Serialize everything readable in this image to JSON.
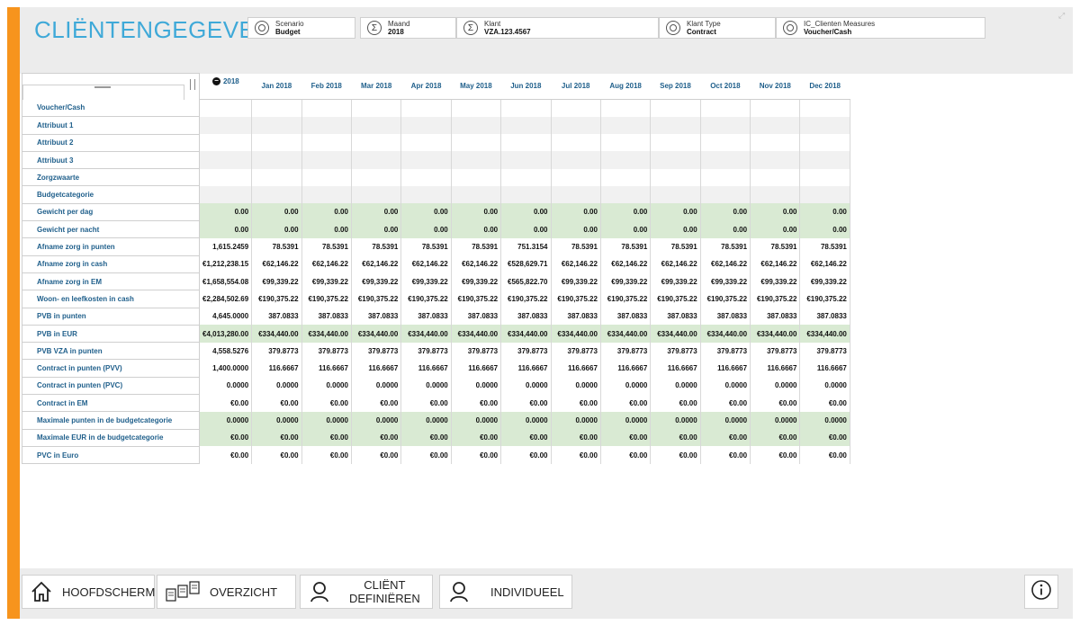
{
  "header": {
    "title": "CLIËNTENGEGEVENS",
    "filters": [
      {
        "label": "Scenario",
        "value": "Budget",
        "icon": "circle-icon"
      },
      {
        "label": "Maand",
        "value": "2018",
        "icon": "sigma-icon"
      },
      {
        "label": "Klant",
        "value": "VZA.123.4567",
        "icon": "sigma-icon"
      },
      {
        "label": "Klant Type",
        "value": "Contract",
        "icon": "circle-icon"
      },
      {
        "label": "IC_Clienten Measures",
        "value": "Voucher/Cash",
        "icon": "circle-icon"
      }
    ]
  },
  "grid": {
    "columns": [
      "2018",
      "Jan 2018",
      "Feb 2018",
      "Mar 2018",
      "Apr 2018",
      "May 2018",
      "Jun 2018",
      "Jul 2018",
      "Aug 2018",
      "Sep 2018",
      "Oct 2018",
      "Nov 2018",
      "Dec 2018"
    ],
    "rows": [
      {
        "label": "Voucher/Cash",
        "style": "plain",
        "values": [
          "",
          "",
          "",
          "",
          "",
          "",
          "",
          "",
          "",
          "",
          "",
          "",
          ""
        ]
      },
      {
        "label": "Attribuut 1",
        "style": "alt",
        "values": [
          "",
          "",
          "",
          "",
          "",
          "",
          "",
          "",
          "",
          "",
          "",
          "",
          ""
        ]
      },
      {
        "label": "Attribuut 2",
        "style": "plain",
        "values": [
          "",
          "",
          "",
          "",
          "",
          "",
          "",
          "",
          "",
          "",
          "",
          "",
          ""
        ]
      },
      {
        "label": "Attribuut 3",
        "style": "alt",
        "values": [
          "",
          "",
          "",
          "",
          "",
          "",
          "",
          "",
          "",
          "",
          "",
          "",
          ""
        ]
      },
      {
        "label": "Zorgzwaarte",
        "style": "plain",
        "values": [
          "",
          "",
          "",
          "",
          "",
          "",
          "",
          "",
          "",
          "",
          "",
          "",
          ""
        ]
      },
      {
        "label": "Budgetcategorie",
        "style": "alt",
        "values": [
          "",
          "",
          "",
          "",
          "",
          "",
          "",
          "",
          "",
          "",
          "",
          "",
          ""
        ]
      },
      {
        "label": "Gewicht per dag",
        "style": "green",
        "values": [
          "0.00",
          "0.00",
          "0.00",
          "0.00",
          "0.00",
          "0.00",
          "0.00",
          "0.00",
          "0.00",
          "0.00",
          "0.00",
          "0.00",
          "0.00"
        ]
      },
      {
        "label": "Gewicht per nacht",
        "style": "green",
        "values": [
          "0.00",
          "0.00",
          "0.00",
          "0.00",
          "0.00",
          "0.00",
          "0.00",
          "0.00",
          "0.00",
          "0.00",
          "0.00",
          "0.00",
          "0.00"
        ]
      },
      {
        "label": "Afname zorg in punten",
        "style": "plain",
        "values": [
          "1,615.2459",
          "78.5391",
          "78.5391",
          "78.5391",
          "78.5391",
          "78.5391",
          "751.3154",
          "78.5391",
          "78.5391",
          "78.5391",
          "78.5391",
          "78.5391",
          "78.5391"
        ]
      },
      {
        "label": "Afname zorg in cash",
        "style": "plain",
        "values": [
          "€1,212,238.15",
          "€62,146.22",
          "€62,146.22",
          "€62,146.22",
          "€62,146.22",
          "€62,146.22",
          "€528,629.71",
          "€62,146.22",
          "€62,146.22",
          "€62,146.22",
          "€62,146.22",
          "€62,146.22",
          "€62,146.22"
        ]
      },
      {
        "label": "Afname zorg in EM",
        "style": "plain",
        "values": [
          "€1,658,554.08",
          "€99,339.22",
          "€99,339.22",
          "€99,339.22",
          "€99,339.22",
          "€99,339.22",
          "€565,822.70",
          "€99,339.22",
          "€99,339.22",
          "€99,339.22",
          "€99,339.22",
          "€99,339.22",
          "€99,339.22"
        ]
      },
      {
        "label": "Woon- en leefkosten in cash",
        "style": "plain",
        "values": [
          "€2,284,502.69",
          "€190,375.22",
          "€190,375.22",
          "€190,375.22",
          "€190,375.22",
          "€190,375.22",
          "€190,375.22",
          "€190,375.22",
          "€190,375.22",
          "€190,375.22",
          "€190,375.22",
          "€190,375.22",
          "€190,375.22"
        ]
      },
      {
        "label": "PVB in punten",
        "style": "plain",
        "values": [
          "4,645.0000",
          "387.0833",
          "387.0833",
          "387.0833",
          "387.0833",
          "387.0833",
          "387.0833",
          "387.0833",
          "387.0833",
          "387.0833",
          "387.0833",
          "387.0833",
          "387.0833"
        ]
      },
      {
        "label": "PVB in EUR",
        "style": "green",
        "values": [
          "€4,013,280.00",
          "€334,440.00",
          "€334,440.00",
          "€334,440.00",
          "€334,440.00",
          "€334,440.00",
          "€334,440.00",
          "€334,440.00",
          "€334,440.00",
          "€334,440.00",
          "€334,440.00",
          "€334,440.00",
          "€334,440.00"
        ]
      },
      {
        "label": "PVB VZA in punten",
        "style": "plain",
        "values": [
          "4,558.5276",
          "379.8773",
          "379.8773",
          "379.8773",
          "379.8773",
          "379.8773",
          "379.8773",
          "379.8773",
          "379.8773",
          "379.8773",
          "379.8773",
          "379.8773",
          "379.8773"
        ]
      },
      {
        "label": "Contract in punten (PVV)",
        "style": "plain",
        "values": [
          "1,400.0000",
          "116.6667",
          "116.6667",
          "116.6667",
          "116.6667",
          "116.6667",
          "116.6667",
          "116.6667",
          "116.6667",
          "116.6667",
          "116.6667",
          "116.6667",
          "116.6667"
        ]
      },
      {
        "label": "Contract in punten (PVC)",
        "style": "plain",
        "values": [
          "0.0000",
          "0.0000",
          "0.0000",
          "0.0000",
          "0.0000",
          "0.0000",
          "0.0000",
          "0.0000",
          "0.0000",
          "0.0000",
          "0.0000",
          "0.0000",
          "0.0000"
        ]
      },
      {
        "label": "Contract in EM",
        "style": "plain",
        "values": [
          "€0.00",
          "€0.00",
          "€0.00",
          "€0.00",
          "€0.00",
          "€0.00",
          "€0.00",
          "€0.00",
          "€0.00",
          "€0.00",
          "€0.00",
          "€0.00",
          "€0.00"
        ]
      },
      {
        "label": "Maximale punten in de budgetcategorie",
        "style": "green",
        "values": [
          "0.0000",
          "0.0000",
          "0.0000",
          "0.0000",
          "0.0000",
          "0.0000",
          "0.0000",
          "0.0000",
          "0.0000",
          "0.0000",
          "0.0000",
          "0.0000",
          "0.0000"
        ]
      },
      {
        "label": "Maximale EUR in de budgetcategorie",
        "style": "green",
        "values": [
          "€0.00",
          "€0.00",
          "€0.00",
          "€0.00",
          "€0.00",
          "€0.00",
          "€0.00",
          "€0.00",
          "€0.00",
          "€0.00",
          "€0.00",
          "€0.00",
          "€0.00"
        ]
      },
      {
        "label": "PVC in Euro",
        "style": "plain",
        "values": [
          "€0.00",
          "€0.00",
          "€0.00",
          "€0.00",
          "€0.00",
          "€0.00",
          "€0.00",
          "€0.00",
          "€0.00",
          "€0.00",
          "€0.00",
          "€0.00",
          "€0.00"
        ]
      }
    ]
  },
  "footer": {
    "buttons": [
      {
        "label": "HOOFDSCHERM",
        "icon": "home-icon"
      },
      {
        "label": "OVERZICHT",
        "icon": "documents-icon"
      },
      {
        "label": "CLIËNT\nDEFINIËREN",
        "line1": "CLIËNT",
        "line2": "DEFINIËREN",
        "icon": "user-icon"
      },
      {
        "label": "INDIVIDUEEL",
        "icon": "user-icon"
      }
    ],
    "info_icon": "info-icon"
  },
  "colors": {
    "accent": "#f7941d",
    "title": "#3fa9d8",
    "row_label": "#1f5f8b",
    "green_cell": "#d9ead3",
    "alt_cell": "#f1f1f1"
  }
}
